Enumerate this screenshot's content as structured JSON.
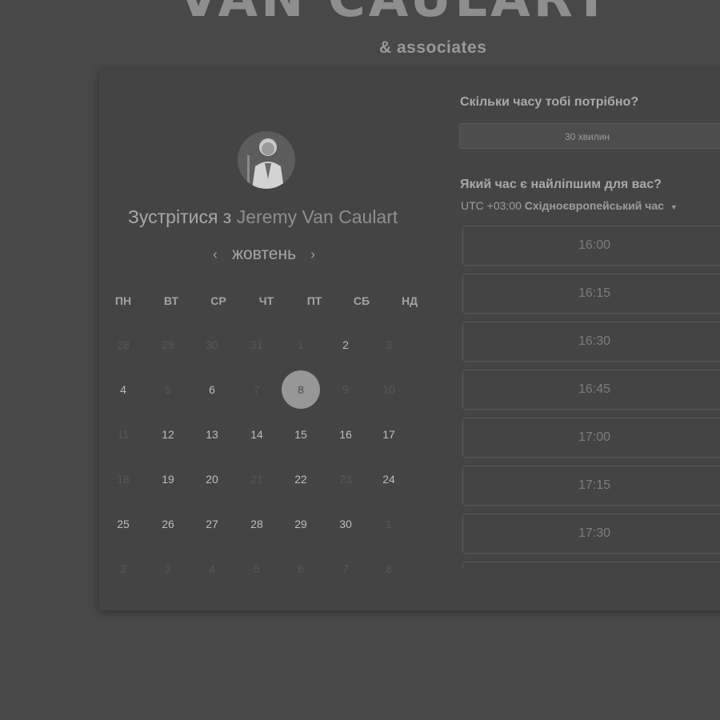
{
  "brand": {
    "name": "VAN CAULART",
    "tagline": "& associates"
  },
  "booking": {
    "title_prefix": "Зустрітися з",
    "host_name": "Jeremy Van Caulart"
  },
  "calendar": {
    "month": "жовтень",
    "prev_icon": "chevron-left-icon",
    "next_icon": "chevron-right-icon",
    "weekdays": [
      "ПН",
      "ВТ",
      "СР",
      "ЧТ",
      "ПТ",
      "СБ",
      "НД"
    ],
    "weeks": [
      [
        {
          "d": "28",
          "s": "dim"
        },
        {
          "d": "29",
          "s": "dim"
        },
        {
          "d": "30",
          "s": "dim"
        },
        {
          "d": "31",
          "s": "dim"
        },
        {
          "d": "1",
          "s": "dim"
        },
        {
          "d": "2",
          "s": "avail"
        },
        {
          "d": "3",
          "s": "dim"
        }
      ],
      [
        {
          "d": "4",
          "s": "avail"
        },
        {
          "d": "5",
          "s": "dim"
        },
        {
          "d": "6",
          "s": "avail"
        },
        {
          "d": "7",
          "s": "dim"
        },
        {
          "d": "8",
          "s": "selected"
        },
        {
          "d": "9",
          "s": "dim"
        },
        {
          "d": "10",
          "s": "dim"
        }
      ],
      [
        {
          "d": "11",
          "s": "dim"
        },
        {
          "d": "12",
          "s": "avail"
        },
        {
          "d": "13",
          "s": "avail"
        },
        {
          "d": "14",
          "s": "avail"
        },
        {
          "d": "15",
          "s": "avail"
        },
        {
          "d": "16",
          "s": "avail"
        },
        {
          "d": "17",
          "s": "avail"
        }
      ],
      [
        {
          "d": "18",
          "s": "dim"
        },
        {
          "d": "19",
          "s": "avail"
        },
        {
          "d": "20",
          "s": "avail"
        },
        {
          "d": "21",
          "s": "dim"
        },
        {
          "d": "22",
          "s": "avail"
        },
        {
          "d": "23",
          "s": "dim"
        },
        {
          "d": "24",
          "s": "avail"
        }
      ],
      [
        {
          "d": "25",
          "s": "avail"
        },
        {
          "d": "26",
          "s": "avail"
        },
        {
          "d": "27",
          "s": "avail"
        },
        {
          "d": "28",
          "s": "avail"
        },
        {
          "d": "29",
          "s": "avail"
        },
        {
          "d": "30",
          "s": "avail"
        },
        {
          "d": "1",
          "s": "dim"
        }
      ],
      [
        {
          "d": "2",
          "s": "dim"
        },
        {
          "d": "3",
          "s": "dim"
        },
        {
          "d": "4",
          "s": "dim"
        },
        {
          "d": "5",
          "s": "dim"
        },
        {
          "d": "6",
          "s": "dim"
        },
        {
          "d": "7",
          "s": "dim"
        },
        {
          "d": "8",
          "s": "dim"
        }
      ]
    ]
  },
  "duration": {
    "question": "Скільки часу тобі потрібно?",
    "selected": "30 хвилин"
  },
  "time": {
    "question": "Який час є найліпшим для вас?",
    "tz_offset": "UTC +03:00",
    "tz_name": "Східноєвропейський час",
    "slots": [
      "16:00",
      "16:15",
      "16:30",
      "16:45",
      "17:00",
      "17:15",
      "17:30",
      ""
    ]
  },
  "colors": {
    "background": "#484848",
    "card": "#444444",
    "selected_day": "#979797"
  }
}
